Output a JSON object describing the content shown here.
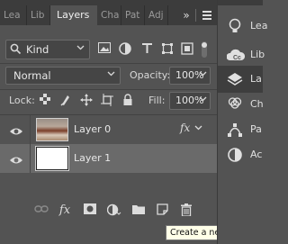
{
  "tabs": [
    {
      "label": "Lea",
      "active": false
    },
    {
      "label": "Lib",
      "active": false
    },
    {
      "label": "Layers",
      "active": true
    },
    {
      "label": "Cha",
      "active": false
    },
    {
      "label": "Pat",
      "active": false
    },
    {
      "label": "Adj",
      "active": false
    }
  ],
  "tab_controls": {
    "collapse": "»",
    "menu_icon": "hamburger-menu-icon"
  },
  "filter": {
    "kind_label": "Kind",
    "icons": [
      "image-filter-icon",
      "adjustment-filter-icon",
      "type-filter-icon",
      "shape-filter-icon",
      "smart-object-filter-icon"
    ]
  },
  "blend": {
    "mode": "Normal",
    "opacity_label": "Opacity:",
    "opacity_value": "100%"
  },
  "lock": {
    "label": "Lock:",
    "fill_label": "Fill:",
    "fill_value": "100%",
    "icons": [
      "lock-transparent-pixels-icon",
      "lock-image-pixels-icon",
      "lock-position-icon",
      "lock-artboard-icon",
      "lock-all-icon"
    ]
  },
  "layers": [
    {
      "name": "Layer 0",
      "visible": true,
      "has_fx": true,
      "fx_label": "fx",
      "selected": false
    },
    {
      "name": "Layer 1",
      "visible": true,
      "has_fx": false,
      "selected": true
    }
  ],
  "bottom_toolbar": [
    "link-layers-icon",
    "add-layer-style-icon",
    "add-mask-icon",
    "new-adjustment-layer-icon",
    "new-group-icon",
    "new-layer-icon",
    "delete-layer-icon"
  ],
  "tooltip": "Create a new layer",
  "dock": [
    {
      "label": "Lea",
      "icon": "lightbulb-icon",
      "active": false
    },
    {
      "label": "Lib",
      "icon": "libraries-icon",
      "active": false
    },
    {
      "label": "La",
      "icon": "layers-icon",
      "active": true
    },
    {
      "label": "Ch",
      "icon": "channels-icon",
      "active": false
    },
    {
      "label": "Pa",
      "icon": "paths-icon",
      "active": false
    },
    {
      "label": "Ac",
      "icon": "adjustments-icon",
      "active": false
    }
  ],
  "colors": {
    "panel": "#535353",
    "tabbar": "#3c3c3c",
    "selected_layer": "#6a6a6a",
    "tooltip_bg": "#ffffe8"
  }
}
